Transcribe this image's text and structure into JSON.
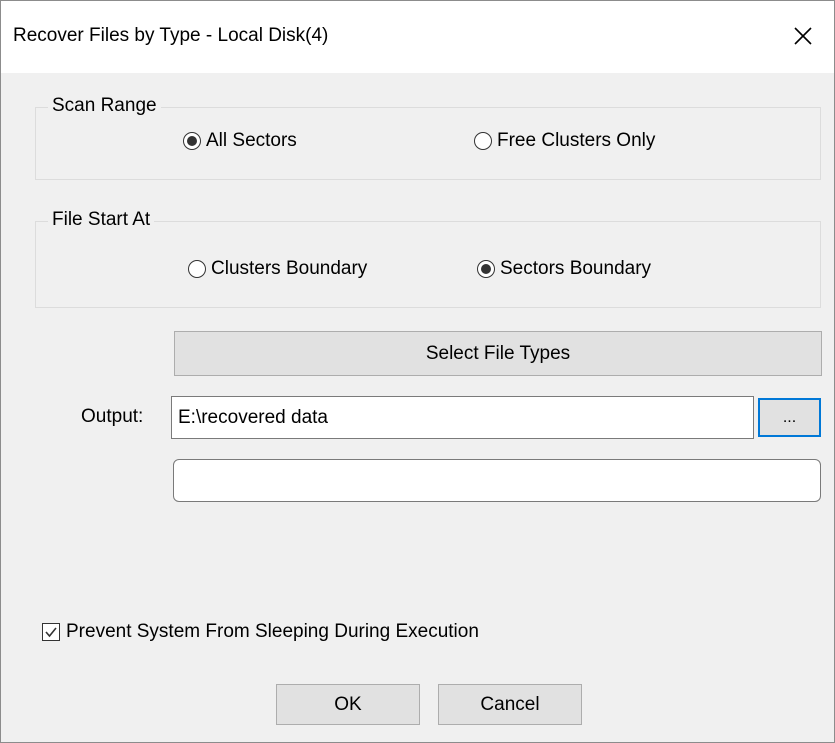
{
  "window": {
    "title": "Recover Files by Type - Local Disk(4)",
    "close_icon": "close-icon"
  },
  "scan_range": {
    "legend": "Scan Range",
    "options": [
      {
        "label": "All Sectors",
        "selected": true
      },
      {
        "label": "Free Clusters Only",
        "selected": false
      }
    ]
  },
  "file_start": {
    "legend": "File Start At",
    "options": [
      {
        "label": "Clusters Boundary",
        "selected": false
      },
      {
        "label": "Sectors Boundary",
        "selected": true
      }
    ]
  },
  "select_types_button": "Select File Types",
  "output": {
    "label": "Output:",
    "value": "E:\\recovered data",
    "browse_label": "..."
  },
  "status_field": {
    "value": ""
  },
  "prevent_sleep": {
    "label": "Prevent System From Sleeping During Execution",
    "checked": true
  },
  "buttons": {
    "ok": "OK",
    "cancel": "Cancel"
  },
  "colors": {
    "dialog_bg": "#f0f0f0",
    "button_bg": "#e1e1e1",
    "focus_border": "#0078d7"
  }
}
